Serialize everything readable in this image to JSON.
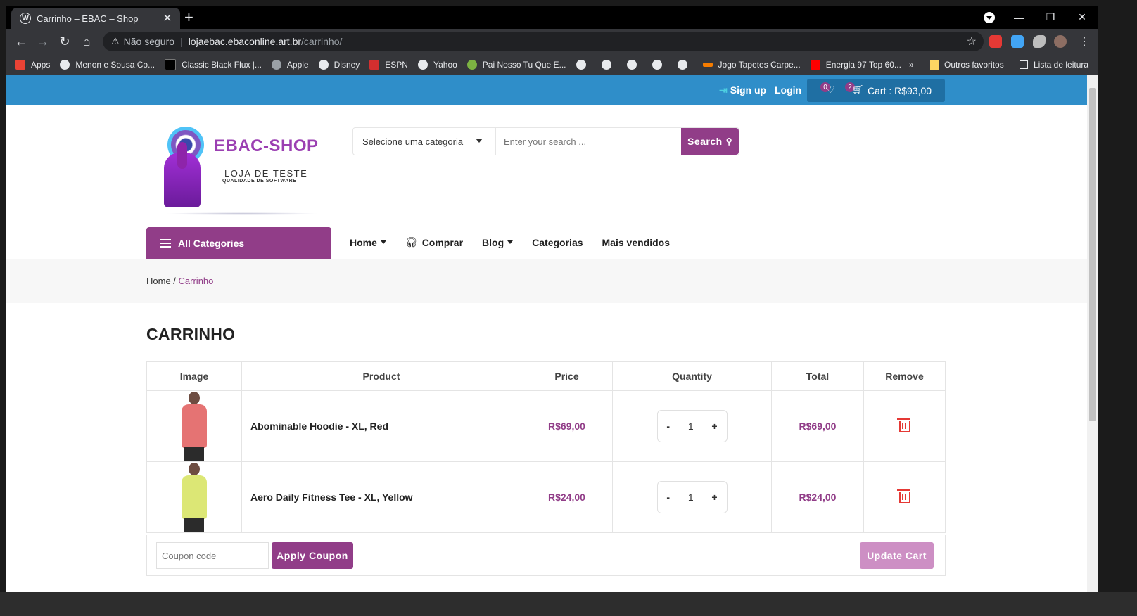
{
  "browser": {
    "tab_title": "Carrinho – EBAC – Shop",
    "tab_close": "✕",
    "new_tab": "+",
    "not_secure": "Não seguro",
    "url_domain": "lojaebac.ebaconline.art.br",
    "url_path": "/carrinho/",
    "bookmarks": [
      {
        "label": "Apps"
      },
      {
        "label": "Menon e Sousa Co..."
      },
      {
        "label": "Classic Black Flux |..."
      },
      {
        "label": "Apple"
      },
      {
        "label": "Disney"
      },
      {
        "label": "ESPN"
      },
      {
        "label": "Yahoo"
      },
      {
        "label": "Pai Nosso Tu Que E..."
      },
      {
        "label": "Jogo Tapetes Carpe..."
      },
      {
        "label": "Energia 97 Top 60..."
      }
    ],
    "bookmarks_more": "»",
    "other_favorites": "Outros favoritos",
    "reading_list": "Lista de leitura"
  },
  "topbar": {
    "signup": "Sign up",
    "login": "Login",
    "wishlist_count": "0",
    "cart_count": "2",
    "cart_label": "Cart : R$93,00"
  },
  "logo": {
    "brand": "EBAC-SHOP",
    "tagline": "LOJA DE TESTE",
    "subtagline": "QUALIDADE DE SOFTWARE"
  },
  "search": {
    "category_label": "Selecione uma categoria",
    "placeholder": "Enter your search ...",
    "button": "Search"
  },
  "nav": {
    "all_categories": "All Categories",
    "items": [
      {
        "label": "Home"
      },
      {
        "label": "Comprar"
      },
      {
        "label": "Blog"
      },
      {
        "label": "Categorias"
      },
      {
        "label": "Mais vendidos"
      }
    ]
  },
  "breadcrumb": {
    "home": "Home",
    "separator": " / ",
    "current": "Carrinho"
  },
  "page_title": "CARRINHO",
  "cart": {
    "headers": [
      "Image",
      "Product",
      "Price",
      "Quantity",
      "Total",
      "Remove"
    ],
    "rows": [
      {
        "product": "Abominable Hoodie - XL, Red",
        "price": "R$69,00",
        "qty": "1",
        "total": "R$69,00",
        "minus": "-",
        "plus": "+",
        "shirt_color": "#e57373"
      },
      {
        "product": "Aero Daily Fitness Tee - XL, Yellow",
        "price": "R$24,00",
        "qty": "1",
        "total": "R$24,00",
        "minus": "-",
        "plus": "+",
        "shirt_color": "#dce775"
      }
    ],
    "coupon_placeholder": "Coupon code",
    "apply_coupon": "Apply Coupon",
    "update_cart": "Update Cart"
  },
  "colors": {
    "accent": "#913d88",
    "topbar": "#2f8ec9"
  }
}
